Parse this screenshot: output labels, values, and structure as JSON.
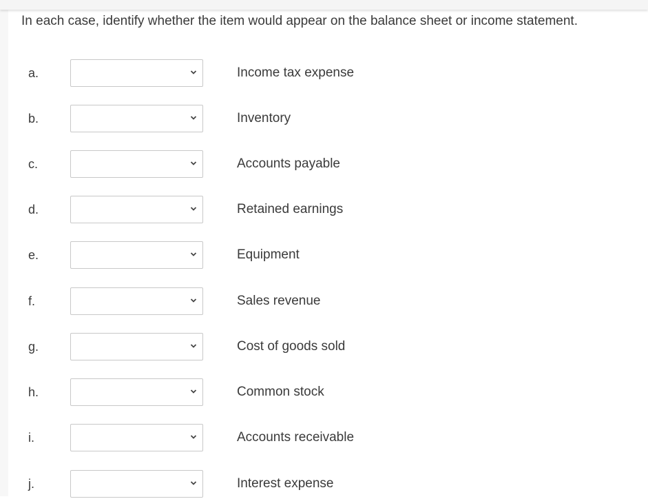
{
  "prompt": "In each case, identify whether the item would appear on the balance sheet or income statement.",
  "items": [
    {
      "letter": "a.",
      "label": "Income tax expense",
      "selected": ""
    },
    {
      "letter": "b.",
      "label": "Inventory",
      "selected": ""
    },
    {
      "letter": "c.",
      "label": "Accounts payable",
      "selected": ""
    },
    {
      "letter": "d.",
      "label": "Retained earnings",
      "selected": ""
    },
    {
      "letter": "e.",
      "label": "Equipment",
      "selected": ""
    },
    {
      "letter": "f.",
      "label": "Sales revenue",
      "selected": ""
    },
    {
      "letter": "g.",
      "label": "Cost of goods sold",
      "selected": ""
    },
    {
      "letter": "h.",
      "label": "Common stock",
      "selected": ""
    },
    {
      "letter": "i.",
      "label": "Accounts receivable",
      "selected": ""
    },
    {
      "letter": "j.",
      "label": "Interest expense",
      "selected": ""
    }
  ],
  "icons": {
    "dropdown": "chevron-down-icon"
  }
}
